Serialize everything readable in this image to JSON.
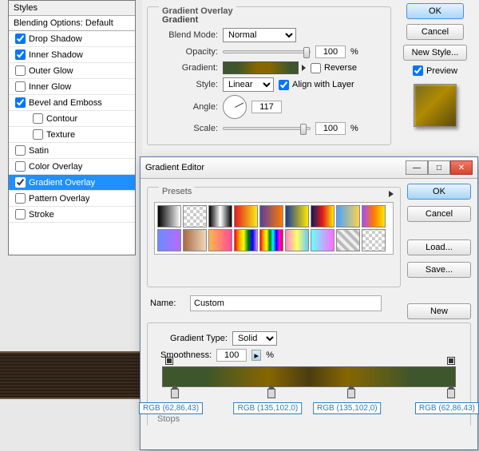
{
  "styles": {
    "header": "Styles",
    "blending": "Blending Options: Default",
    "items": [
      {
        "label": "Drop Shadow",
        "checked": true,
        "indent": false,
        "selected": false
      },
      {
        "label": "Inner Shadow",
        "checked": true,
        "indent": false,
        "selected": false
      },
      {
        "label": "Outer Glow",
        "checked": false,
        "indent": false,
        "selected": false
      },
      {
        "label": "Inner Glow",
        "checked": false,
        "indent": false,
        "selected": false
      },
      {
        "label": "Bevel and Emboss",
        "checked": true,
        "indent": false,
        "selected": false
      },
      {
        "label": "Contour",
        "checked": false,
        "indent": true,
        "selected": false
      },
      {
        "label": "Texture",
        "checked": false,
        "indent": true,
        "selected": false
      },
      {
        "label": "Satin",
        "checked": false,
        "indent": false,
        "selected": false
      },
      {
        "label": "Color Overlay",
        "checked": false,
        "indent": false,
        "selected": false
      },
      {
        "label": "Gradient Overlay",
        "checked": true,
        "indent": false,
        "selected": true
      },
      {
        "label": "Pattern Overlay",
        "checked": false,
        "indent": false,
        "selected": false
      },
      {
        "label": "Stroke",
        "checked": false,
        "indent": false,
        "selected": false
      }
    ]
  },
  "ls": {
    "group_title": "Gradient Overlay",
    "sub_title": "Gradient",
    "blend_mode_label": "Blend Mode:",
    "blend_mode_value": "Normal",
    "opacity_label": "Opacity:",
    "opacity_value": "100",
    "percent": "%",
    "gradient_label": "Gradient:",
    "reverse_label": "Reverse",
    "style_label": "Style:",
    "style_value": "Linear",
    "align_label": "Align with Layer",
    "angle_label": "Angle:",
    "angle_value": "117",
    "scale_label": "Scale:",
    "scale_value": "100",
    "ok": "OK",
    "cancel": "Cancel",
    "new_style": "New Style...",
    "preview_label": "Preview"
  },
  "ge": {
    "title": "Gradient Editor",
    "presets_label": "Presets",
    "name_label": "Name:",
    "name_value": "Custom",
    "gradtype_label": "Gradient Type:",
    "gradtype_value": "Solid",
    "smooth_label": "Smoothness:",
    "smooth_value": "100",
    "percent": "%",
    "ok": "OK",
    "cancel": "Cancel",
    "load": "Load...",
    "save": "Save...",
    "new": "New",
    "stops_label": "Stops",
    "preset_gradients": [
      "linear-gradient(90deg,#000,#fff)",
      "repeating-conic-gradient(#ccc 0 25%,#fff 0 50%) 0/8px 8px",
      "linear-gradient(90deg,#000,#fff,#000)",
      "linear-gradient(90deg,#e31b23,#f7ec13)",
      "linear-gradient(90deg,#5a3e9b,#ff7a00)",
      "linear-gradient(90deg,#1b3f8f,#ffe800)",
      "linear-gradient(90deg,#101a5a,#e21b1b,#ffe800)",
      "linear-gradient(90deg,#4aa3ff,#ffd24a)",
      "linear-gradient(90deg,#a64aff,#ff7a00,#ffe800)",
      "linear-gradient(90deg,#6a8cff,#b86aff)",
      "linear-gradient(90deg,#a86a4a,#f0d8b8)",
      "linear-gradient(90deg,#ffb84a,#ff4a9a)",
      "linear-gradient(90deg,red,orange,yellow,green,blue,violet)",
      "linear-gradient(90deg,red,orange,yellow,green,cyan,blue,magenta,red)",
      "linear-gradient(90deg,#ff88cc,#ffff66,#66ccff)",
      "linear-gradient(90deg,#6affff,#ff6aff)",
      "repeating-linear-gradient(45deg,#bbb 0 4px,#eee 4px 8px)",
      "repeating-conic-gradient(#ccc 0 25%,#fff 0 50%) 0/8px 8px"
    ],
    "color_stops": [
      {
        "pos": 3,
        "label": "RGB (62,86,43)"
      },
      {
        "pos": 36,
        "label": "RGB (135,102,0)"
      },
      {
        "pos": 63,
        "label": "RGB (135,102,0)"
      },
      {
        "pos": 97,
        "label": "RGB (62,86,43)"
      }
    ],
    "opacity_stops": [
      {
        "pos": 1
      },
      {
        "pos": 97
      }
    ]
  }
}
